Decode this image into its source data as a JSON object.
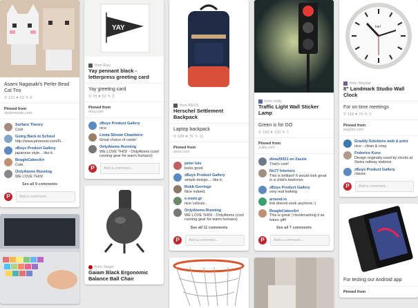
{
  "pins": [
    {
      "col": 0,
      "description": "Asami Nagasaki's Perler Bead Cat Trio",
      "source": "",
      "title": "",
      "stats": "⚲ 131  ♥ 52  ✎ 6",
      "pinned_from_label": "Pinned from",
      "pinned_from_site": "studiomode.com",
      "comments": [
        {
          "author": "Surface Theory",
          "text": "Cool"
        },
        {
          "author": "Going Back to School",
          "text": "http://www.pinterest.com/Fi..."
        },
        {
          "author": "zBuys Product Gallery",
          "text": "japanese style... like it."
        },
        {
          "author": "BeagleCakesArt",
          "text": "Cute."
        },
        {
          "author": "OnlyAtoms Running",
          "text": "WE LOVE THIS!"
        }
      ],
      "see_all": "See all 9 comments",
      "add_placeholder": "Add a comment..."
    },
    {
      "col": 1,
      "source": "from Etsy",
      "title": "Yay pennant black - letterpress greeting card",
      "description": "Yay greeting card",
      "stats": "⚲ 78  ♥ 52  ✎ 3",
      "pinned_from_label": "Pinned from",
      "pinned_from_site": "etsy.com",
      "comments": [
        {
          "author": "zBuys Product Gallery",
          "text": "nice"
        },
        {
          "author": "Linda Shown Chambers",
          "text": "Great choice of cards!"
        },
        {
          "author": "OnlyAtoms Running",
          "text": "WE LOVE THIS! - OnlyAtoms (cool running gear for warm humans)"
        }
      ],
      "see_all": "",
      "add_placeholder": "Add a comment..."
    },
    {
      "col": 2,
      "source": "from ASOS",
      "title": "Herschel Settlement Backpack",
      "description": "Laptop backpack",
      "stats": "⚲ 188  ♥ 76  ✎ 11",
      "pinned_from_label": "Pinned from",
      "pinned_from_site": "asos.com",
      "comments": [
        {
          "author": "peter luis",
          "text": "looks good"
        },
        {
          "author": "zBuys Product Gallery",
          "text": "simple design.... like it."
        },
        {
          "author": "Robb Gorringe",
          "text": "Nice indeed."
        },
        {
          "author": "e-moto.gr",
          "text": "nice colours.."
        },
        {
          "author": "OnlyAtoms Running",
          "text": "WE LOVE THIS! - OnlyAtoms (cool running gear for warm humans)"
        }
      ],
      "see_all": "See all 11 comments",
      "add_placeholder": "Add a comment..."
    },
    {
      "col": 3,
      "source": "from zulily",
      "title": "Traffic Light Wall Sticker Lamp",
      "description": "Green is for GO",
      "stats": "⚲ 190  ♥ 133  ✎ 7",
      "pinned_from_label": "Pinned from",
      "pinned_from_site": "zulily.com",
      "comments": [
        {
          "author": "dlew20021 on Zazzle",
          "text": "That's cool!"
        },
        {
          "author": "No77 Interiors",
          "text": "This is brilliant! It would look great in a child's bedroom"
        },
        {
          "author": "zBuys Product Gallery",
          "text": "very real looking"
        },
        {
          "author": "around.io",
          "text": "link doesnt work anymore.:)"
        },
        {
          "author": "BeagleCakesArt",
          "text": "This is great :) bookmarking it as future gift!"
        }
      ],
      "see_all": "See all 7 comments",
      "add_placeholder": "Add a comment..."
    },
    {
      "col": 4,
      "source": "from Wayfair",
      "title": "8\" Landmark Studio Wall Clock",
      "description": "For on time meetings",
      "stats": "⚲ 118  ♥ 70  ✎ 3",
      "pinned_from_label": "Pinned from",
      "pinned_from_site": "wayfair.com",
      "comments": [
        {
          "author": "Graddy Solutions web & print",
          "text": "nice - clean & crisp"
        },
        {
          "author": "Federico Kunz",
          "text": "Design originally used by clocks at Swiss railway stations."
        },
        {
          "author": "zBuys Product Gallery",
          "text": "classic"
        }
      ],
      "see_all": "",
      "add_placeholder": "Add a comment..."
    }
  ],
  "row2": {
    "target_source": "from Target",
    "target_title": "Gaiam Black Ergonomic Balance Ball Chair",
    "android_desc": "For testing our Android app",
    "android_pinned": "Pinned from"
  },
  "image_text": {
    "yay": "YAY",
    "clock_brand": "karl"
  },
  "colors": {
    "pinterest_red": "#c8232c",
    "background": "#e9e9e9"
  }
}
